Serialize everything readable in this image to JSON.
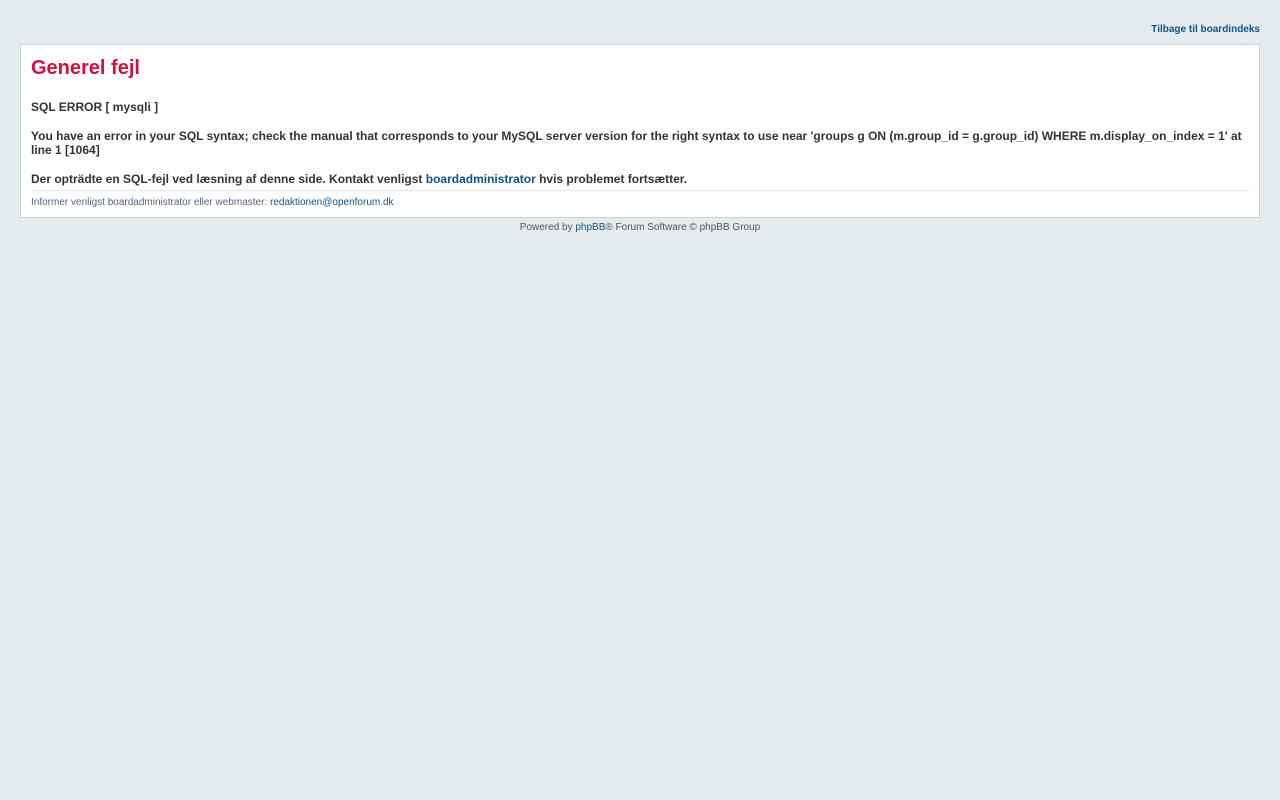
{
  "header": {
    "back_link": "Tilbage til boardindeks"
  },
  "panel": {
    "title": "Generel fejl",
    "sql_error": "SQL ERROR [ mysqli ]",
    "error_detail": "You have an error in your SQL syntax; check the manual that corresponds to your MySQL server version for the right syntax to use near 'groups g ON (m.group_id = g.group_id) WHERE m.display_on_index = 1' at line 1 [1064]",
    "notice_prefix": "Der opträdte en SQL-fejl ved læsning af denne side. Kontakt venligst ",
    "notice_link": "boardadministrator",
    "notice_suffix": " hvis problemet fortsætter.",
    "contact_prefix": "Informer venligst boardadministrator eller webmaster: ",
    "contact_email": "redaktionen@openforum.dk"
  },
  "footer": {
    "powered_by": "Powered by ",
    "phpbb_link": "phpBB",
    "suffix": "® Forum Software © phpBB Group"
  },
  "colors": {
    "background": "#e4ebed",
    "title": "#d31141",
    "link": "#105289"
  }
}
